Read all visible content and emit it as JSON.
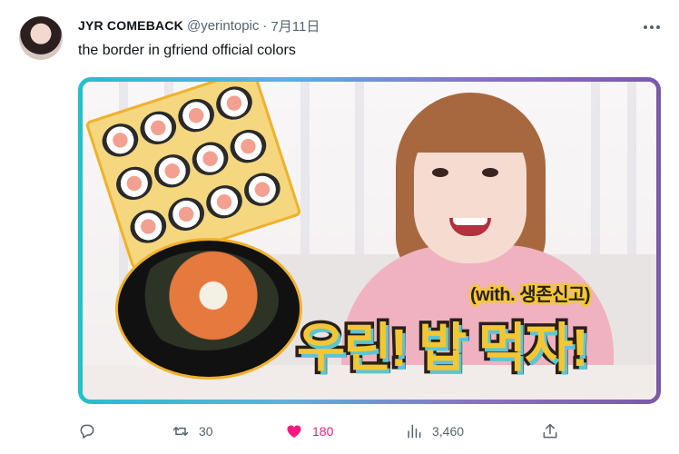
{
  "author": {
    "name": "JYR COMEBACK",
    "handle": "@yerintopic",
    "separator": "·",
    "time": "7月11日"
  },
  "tweet": {
    "text": "the border in gfriend official colors"
  },
  "media": {
    "subtitle": "(with. 생존신고)",
    "headline": "우린! 밥 먹자!",
    "border_colors": [
      "#22c0c8",
      "#5db1e0",
      "#8a6fc0",
      "#7a5aa9"
    ]
  },
  "actions": {
    "reply_icon": "reply-icon",
    "retweet_icon": "retweet-icon",
    "retweet_count": "30",
    "like_icon": "heart-icon",
    "like_count": "180",
    "like_color": "#f91880",
    "views_icon": "analytics-icon",
    "view_count": "3,460",
    "share_icon": "share-icon"
  }
}
